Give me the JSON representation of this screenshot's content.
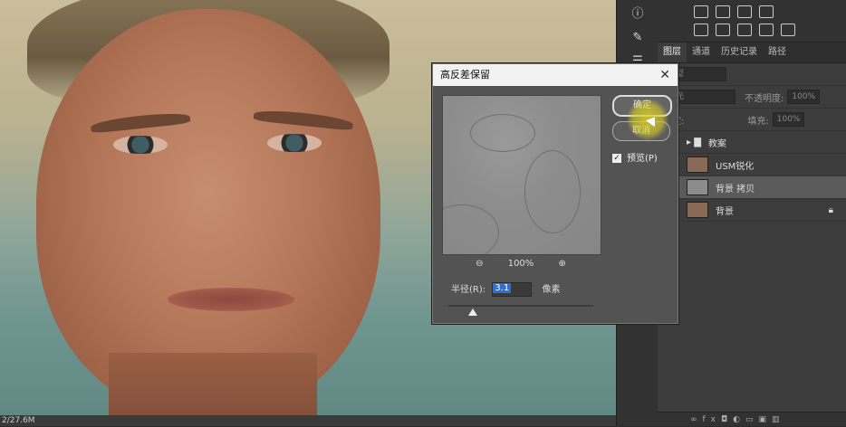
{
  "canvas": {
    "status_text": "2/27.6M",
    "photo_icon": "portrait-photo"
  },
  "tool_strip": {
    "icons": [
      "info-icon",
      "brush-icon",
      "sliders-icon"
    ]
  },
  "panel": {
    "tabs": [
      "图层",
      "通道",
      "历史记录",
      "路径"
    ],
    "active_tab": "图层",
    "kind_label": "类型",
    "blend_mode": "柔光",
    "opacity_label": "不透明度:",
    "opacity_value": "100%",
    "lock_label": "锁定:",
    "fill_label": "填充:",
    "fill_value": "100%",
    "layers": [
      {
        "name": "教案",
        "type": "group"
      },
      {
        "name": "USM锐化",
        "type": "layer"
      },
      {
        "name": "背景 拷贝",
        "type": "layer",
        "selected": true
      },
      {
        "name": "背景",
        "type": "layer",
        "locked": true
      }
    ]
  },
  "dialog": {
    "title": "高反差保留",
    "close_icon": "close-icon",
    "ok_label": "确定",
    "cancel_label": "取消",
    "preview_label": "预览(P)",
    "preview_checked": true,
    "zoom_value": "100%",
    "radius_label": "半径(R):",
    "radius_value": "3.1",
    "unit_label": "像素",
    "slider_fraction": 0.17
  },
  "colors": {
    "dialog_bg": "#535353",
    "panel_bg": "#3c3c3c",
    "selected_layer": "#5a5a5a",
    "radius_highlight": "#2f6fd0",
    "cursor_highlight": "#dcd228"
  }
}
